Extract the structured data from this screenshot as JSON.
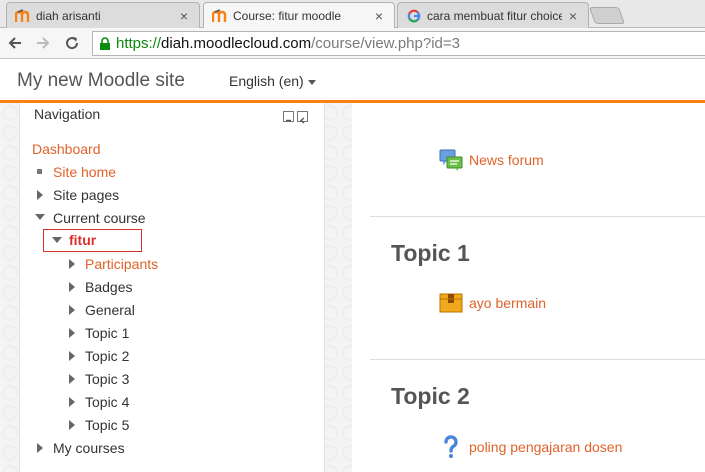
{
  "browser": {
    "tabs": [
      {
        "title": "diah arisanti",
        "favicon": "moodle-icon",
        "active": false
      },
      {
        "title": "Course: fitur moodle",
        "favicon": "moodle-icon",
        "active": true
      },
      {
        "title": "cara membuat fitur choice",
        "favicon": "google-icon",
        "active": false
      }
    ],
    "close_glyph": "×",
    "url": {
      "scheme": "https://",
      "host": "diah.moodlecloud.com",
      "path": "/course/view.php?id=3"
    }
  },
  "header": {
    "site_name": "My new Moodle site",
    "language": "English (en)"
  },
  "navigation": {
    "heading": "Navigation",
    "dashboard": "Dashboard",
    "site_home": "Site home",
    "site_pages": "Site pages",
    "current_course": "Current course",
    "course": "fitur",
    "participants": "Participants",
    "badges": "Badges",
    "general": "General",
    "topics": [
      "Topic 1",
      "Topic 2",
      "Topic 3",
      "Topic 4",
      "Topic 5"
    ],
    "my_courses": "My courses"
  },
  "main": {
    "news_forum": "News forum",
    "sections": [
      {
        "title": "Topic 1",
        "activity": "ayo bermain",
        "icon": "package-icon"
      },
      {
        "title": "Topic 2",
        "activity": "poling pengajaran dosen",
        "icon": "question-icon"
      }
    ]
  },
  "colors": {
    "accent": "#f98012",
    "link": "#e1622a",
    "highlight": "#d9302c",
    "secure": "#0b8a0b"
  }
}
